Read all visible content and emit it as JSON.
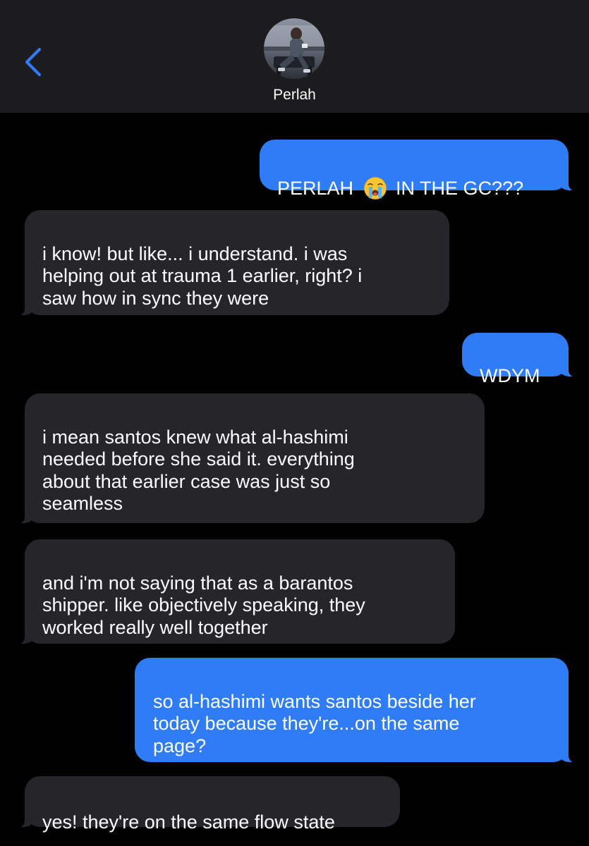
{
  "header": {
    "contact_name": "Perlah",
    "back_icon": "chevron-left-icon",
    "avatar_icon": "contact-photo"
  },
  "colors": {
    "header_bg": "#1c1c1e",
    "background": "#000000",
    "incoming_bubble": "#26252a",
    "outgoing_bubble": "#2f7cf6",
    "accent": "#2f7cf6",
    "text": "#ffffff"
  },
  "messages": [
    {
      "direction": "outgoing",
      "text_before": "PERLAH",
      "emoji": "loudly-crying-face-icon",
      "text_after": "IN THE GC???"
    },
    {
      "direction": "incoming",
      "text": "i know! but like... i understand. i was\nhelping out at trauma 1 earlier, right? i\nsaw how in sync they were"
    },
    {
      "direction": "outgoing",
      "text": "WDYM"
    },
    {
      "direction": "incoming",
      "text": "i mean santos knew what al-hashimi\nneeded before she said it. everything\nabout that earlier case was just so\nseamless"
    },
    {
      "direction": "incoming",
      "text": "and i'm not saying that as a barantos\nshipper. like objectively speaking, they\nworked really well together"
    },
    {
      "direction": "outgoing",
      "text": "so al-hashimi wants santos beside her\ntoday because they're...on the same\npage?"
    },
    {
      "direction": "incoming",
      "text": "yes! they're on the same flow state"
    }
  ]
}
